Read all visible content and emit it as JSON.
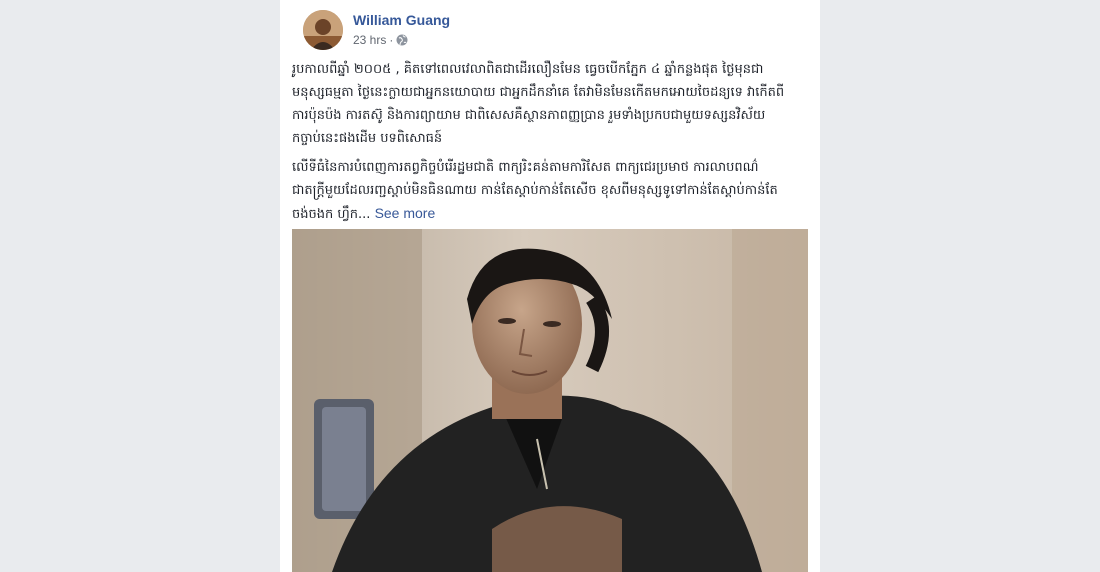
{
  "post": {
    "author": "William Guang",
    "time": "23 hrs",
    "separator": "·",
    "privacy_icon": "globe-icon",
    "paragraphs": [
      "រូបកាលពីឆ្នាំ ២០០៥ , គិតទៅពេលវេលាពិតជាដើរលឿនមែន ធ្វេចបើកភ្នែក ៤ ឆ្នាំកន្លងផុត ថ្ងៃមុនជាមនុស្សធម្មតា ថ្ងៃនេះក្លាយជាអ្នកនយោបាយ ជាអ្នកដឹកនាំគេ តែវាមិនមែនកើតមកអោយចៃដន្យទេ វាកើតពីការប៉ុនប៉ង ការតស៊ូ និងការព្យាយាម ជាពិសេសគឺស្ថានភាពញ្ញប្រាន រួមទាំងប្រកបជាមួយទស្សនវិស័យ កច្ចាប់នេះផងដើម បទពិសោធន៍",
      "លើទីធំនៃការបំពេញការតព្វកិច្ចបំរើរដ្ឋមជាតិ ពាក្យរិះគន់តាមការិសែត ពាក្យជេរប្រមាថ ការលាបពណ៌ ជាតក្រ្តីមួយដែលរញ្ជស្តាប់មិនធិនណាយ កាន់តែស្តាប់កាន់តែសើច ខុសពីមនុស្សទូទៅកាន់តែស្តាប់កាន់តែចង់ចងក ហ្វឹក..."
    ],
    "see_more": "See more"
  }
}
